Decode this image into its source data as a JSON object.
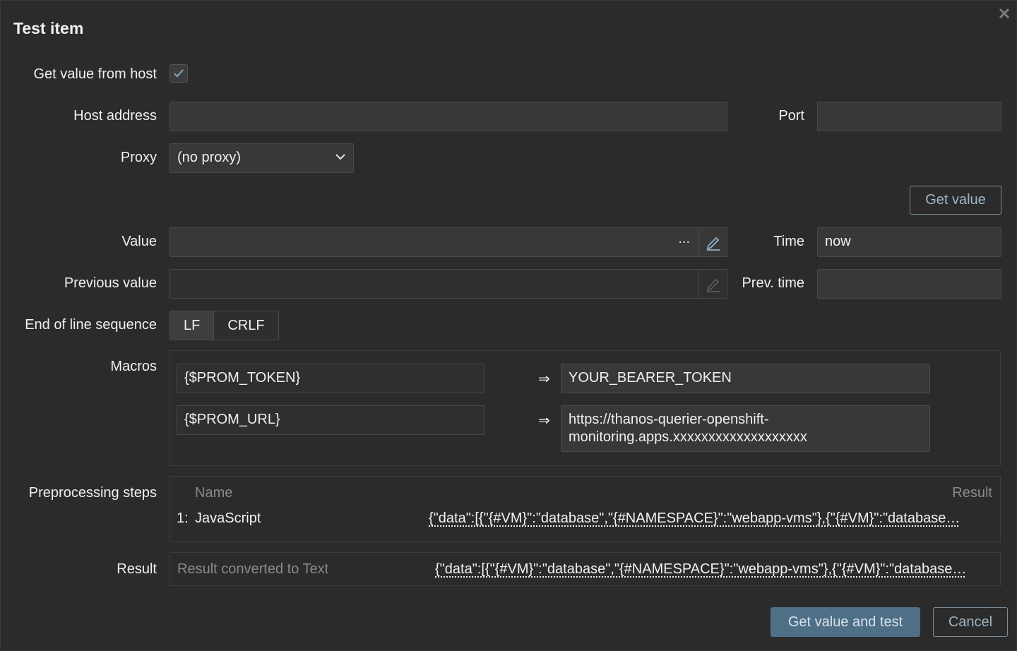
{
  "dialog": {
    "title": "Test item"
  },
  "form": {
    "get_value_from_host_label": "Get value from host",
    "get_value_from_host_checked": true,
    "host_address_label": "Host address",
    "host_address_value": "",
    "port_label": "Port",
    "port_value": "",
    "proxy_label": "Proxy",
    "proxy_selected": "(no proxy)",
    "get_value_button": "Get value",
    "value_label": "Value",
    "value_value": "",
    "value_ellipsis": "...",
    "time_label": "Time",
    "time_value": "now",
    "previous_value_label": "Previous value",
    "previous_value_value": "",
    "prev_time_label": "Prev. time",
    "prev_time_value": "",
    "eol_label": "End of line sequence",
    "eol_options": [
      "LF",
      "CRLF"
    ],
    "eol_selected": "LF",
    "macros_label": "Macros",
    "macros": [
      {
        "name": "{$PROM_TOKEN}",
        "arrow": "⇒",
        "value": "YOUR_BEARER_TOKEN"
      },
      {
        "name": "{$PROM_URL}",
        "arrow": "⇒",
        "value_line1": "https://thanos-querier-openshift-",
        "value_line2": "monitoring.apps.xxxxxxxxxxxxxxxxxxx"
      }
    ],
    "preprocessing_label": "Preprocessing steps",
    "preprocessing_headers": {
      "name": "Name",
      "result": "Result"
    },
    "preprocessing_steps": [
      {
        "index": "1:",
        "name": "JavaScript",
        "result": "{\"data\":[{\"{#VM}\":\"database\",\"{#NAMESPACE}\":\"webapp-vms\"},{\"{#VM}\":\"database…"
      }
    ],
    "result_label": "Result",
    "result_placeholder": "Result converted to Text",
    "result_value": "{\"data\":[{\"{#VM}\":\"database\",\"{#NAMESPACE}\":\"webapp-vms\"},{\"{#VM}\":\"database…"
  },
  "footer": {
    "test_button": "Get value and test",
    "cancel_button": "Cancel"
  },
  "icons": {
    "close": "close-icon",
    "checkmark": "checkmark-icon",
    "chevron": "chevron-down-icon",
    "pencil": "pencil-icon"
  }
}
